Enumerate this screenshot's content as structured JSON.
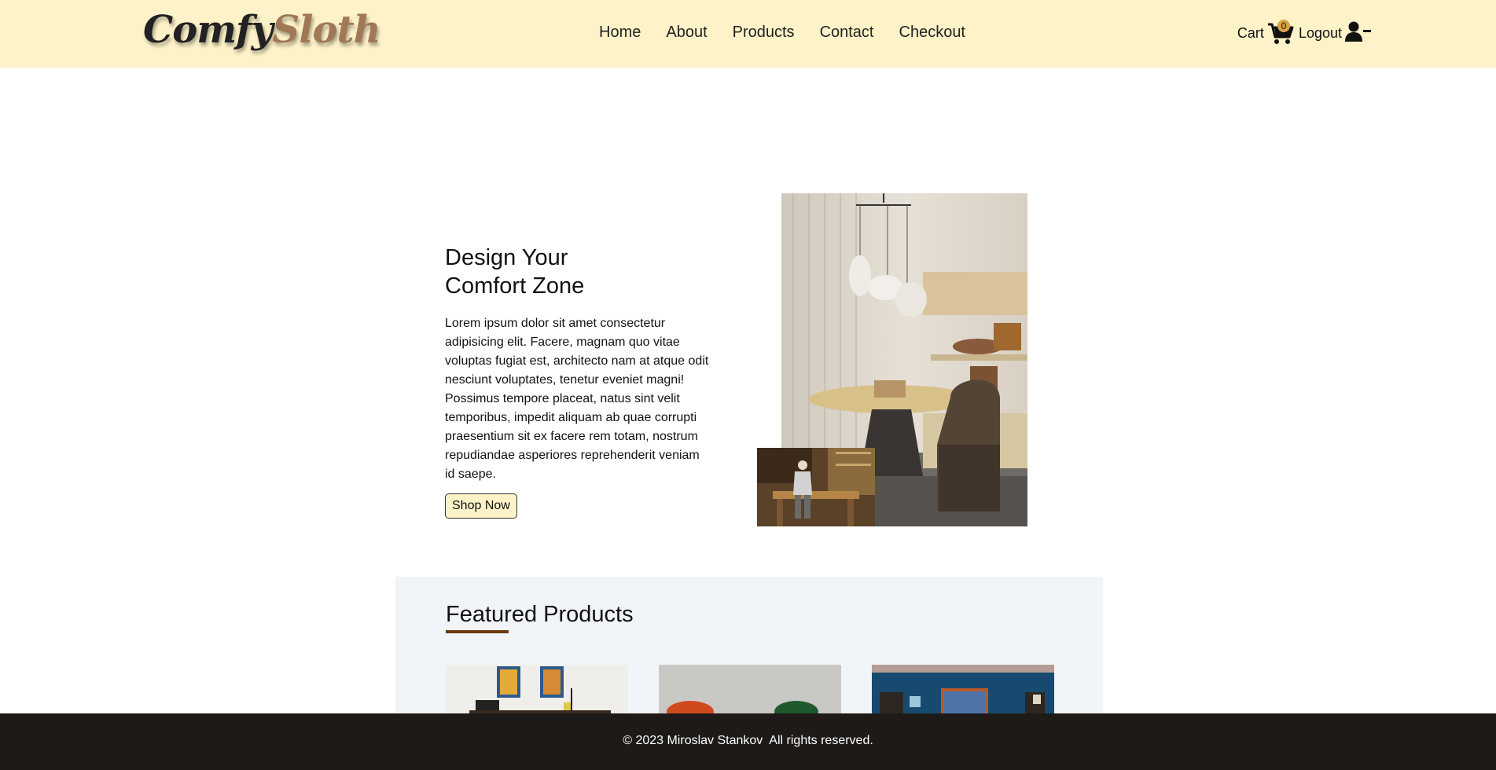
{
  "brand": {
    "part1": "Comfy",
    "part2": "Sloth"
  },
  "nav": {
    "links": [
      "Home",
      "About",
      "Products",
      "Contact",
      "Checkout"
    ],
    "cart_label": "Cart",
    "cart_count": "0",
    "logout_label": "Logout"
  },
  "hero": {
    "title_line1": "Design Your",
    "title_line2": "Comfort Zone",
    "description": "Lorem ipsum dolor sit amet consectetur adipisicing elit. Facere, magnam quo vitae voluptas fugiat est, architecto nam at atque odit nesciunt voluptates, tenetur eveniet magni! Possimus tempore placeat, natus sint velit temporibus, impedit aliquam ab quae corrupti praesentium sit ex facere rem totam, nostrum repudiandae asperiores reprehenderit veniam id saepe.",
    "button_label": "Shop Now"
  },
  "featured": {
    "title": "Featured Products"
  },
  "footer": {
    "text": "© 2023 Miroslav Stankov  All rights reserved."
  },
  "colors": {
    "navbar_bg": "#fdf2c8",
    "brand_accent": "#a07856",
    "footer_bg": "#1e1a17",
    "featured_bg": "#f1f4f8",
    "underline": "#6b3a12"
  }
}
